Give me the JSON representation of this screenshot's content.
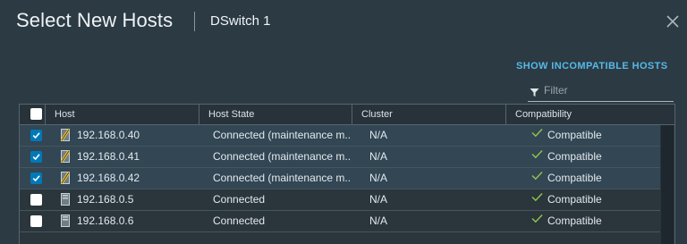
{
  "dialog": {
    "title": "Select New Hosts",
    "subtitle": "DSwitch 1",
    "close_icon": "close-icon"
  },
  "toolbar": {
    "show_incompatible_label": "SHOW INCOMPATIBLE HOSTS",
    "filter_placeholder": "Filter",
    "filter_icon": "filter-icon"
  },
  "table": {
    "columns": [
      "Host",
      "Host State",
      "Cluster",
      "Compatibility"
    ],
    "rows": [
      {
        "selected": true,
        "icon": "host-maintenance-icon",
        "host": "192.168.0.40",
        "state": "Connected (maintenance m...",
        "cluster": "N/A",
        "compatibility": "Compatible"
      },
      {
        "selected": true,
        "icon": "host-maintenance-icon",
        "host": "192.168.0.41",
        "state": "Connected (maintenance m...",
        "cluster": "N/A",
        "compatibility": "Compatible"
      },
      {
        "selected": true,
        "icon": "host-maintenance-icon",
        "host": "192.168.0.42",
        "state": "Connected (maintenance m...",
        "cluster": "N/A",
        "compatibility": "Compatible"
      },
      {
        "selected": false,
        "icon": "host-icon",
        "host": "192.168.0.5",
        "state": "Connected",
        "cluster": "N/A",
        "compatibility": "Compatible"
      },
      {
        "selected": false,
        "icon": "host-icon",
        "host": "192.168.0.6",
        "state": "Connected",
        "cluster": "N/A",
        "compatibility": "Compatible"
      }
    ]
  },
  "colors": {
    "background": "#2c3a43",
    "accent": "#55b9ea",
    "checkbox": "#0079b8",
    "compatible": "#8fc24c",
    "selected_row": "#324654"
  }
}
